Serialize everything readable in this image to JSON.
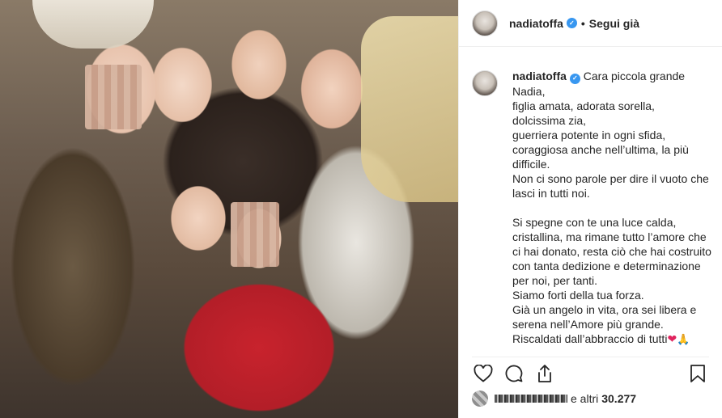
{
  "post": {
    "photo_alt": "",
    "header": {
      "username": "nadiatoffa",
      "separator": "•",
      "follow_label": "Segui già"
    },
    "caption": {
      "username": "nadiatoffa",
      "text": "Cara piccola grande Nadia,\nfiglia amata, adorata sorella,\ndolcissima zia,\nguerriera potente in ogni sfida,\ncoraggiosa anche nell’ultima, la più difficile.\nNon ci sono parole per dire il vuoto che lasci in tutti noi.\n\nSi spegne con te una luce calda, cristallina, ma rimane tutto l’amore che ci hai donato, resta ciò che hai costruito con tanta dedizione e determinazione per noi, per tanti.\nSiamo forti della tua forza.\nGià un angelo in vita, ora sei libera e serena nell’Amore più grande.\nRiscaldati dall’abbraccio di tutti",
      "emoji_heart": "❤",
      "emoji_pray": "🙏"
    },
    "likes": {
      "prefix_obscured": "",
      "and_others": "e altri",
      "count": "30.277"
    },
    "timestamp": ""
  },
  "icons": [
    "heart-icon",
    "comment-icon",
    "share-icon",
    "bookmark-icon",
    "verified-badge-icon"
  ],
  "colors": {
    "verified": "#3897f0",
    "text": "#262626",
    "border": "#efefef"
  }
}
